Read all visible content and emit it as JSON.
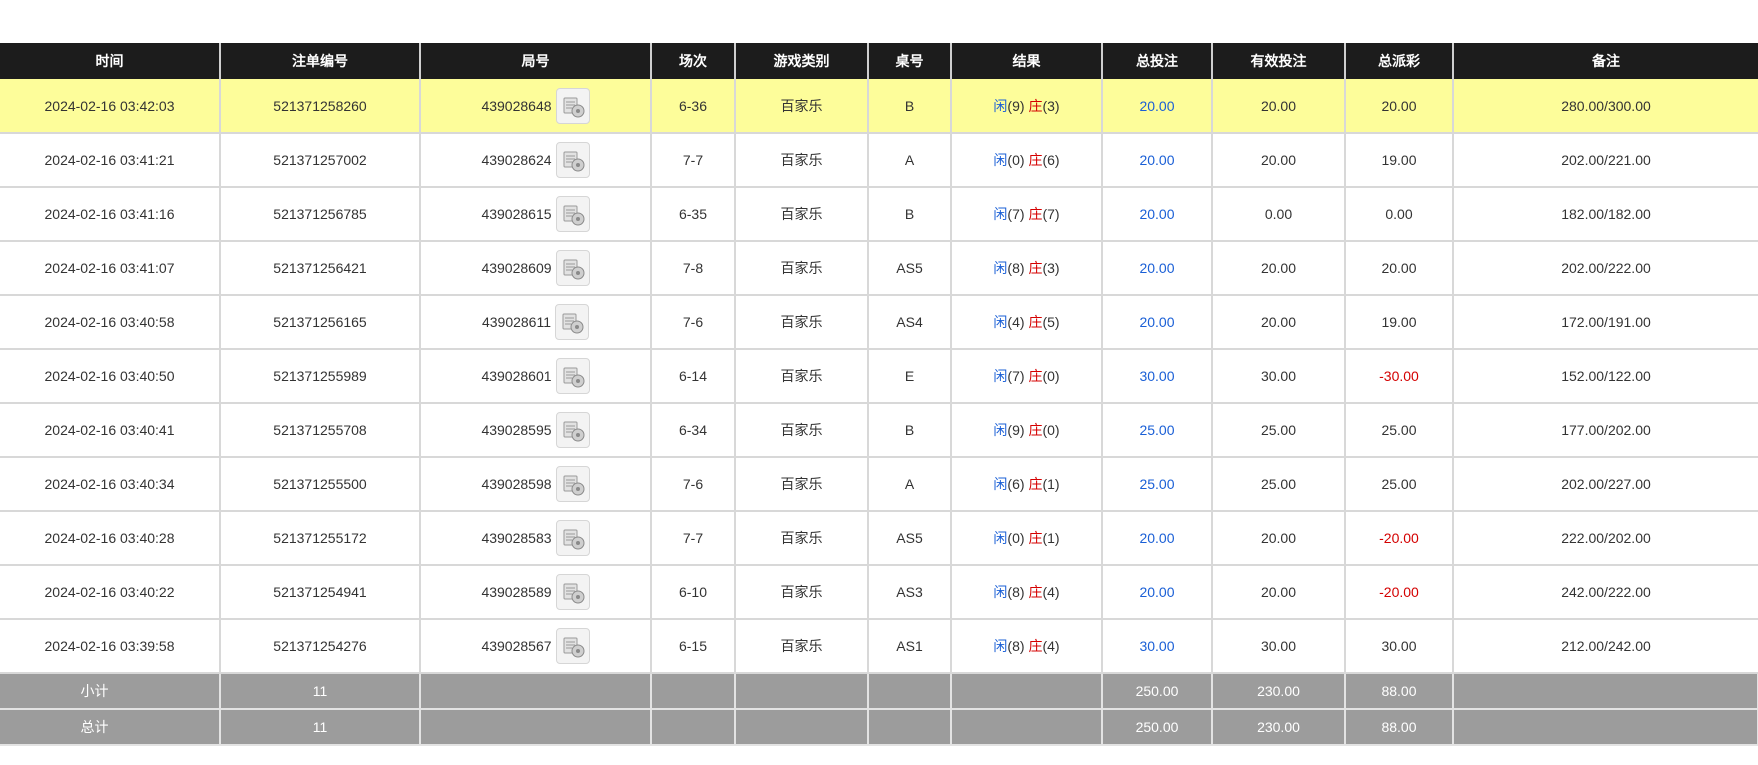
{
  "headers": [
    "时间",
    "注单编号",
    "局号",
    "场次",
    "游戏类别",
    "桌号",
    "结果",
    "总投注",
    "有效投注",
    "总派彩",
    "备注"
  ],
  "rows": [
    {
      "time": "2024-02-16 03:42:03",
      "bet_id": "521371258260",
      "round": "439028648",
      "session": "6-36",
      "game": "百家乐",
      "table": "B",
      "player_label": "闲",
      "player_score": "(9)",
      "banker_label": "庄",
      "banker_score": "(3)",
      "total_bet": "20.00",
      "valid_bet": "20.00",
      "payout": "20.00",
      "payout_negative": false,
      "note": "280.00/300.00",
      "highlight": true
    },
    {
      "time": "2024-02-16 03:41:21",
      "bet_id": "521371257002",
      "round": "439028624",
      "session": "7-7",
      "game": "百家乐",
      "table": "A",
      "player_label": "闲",
      "player_score": "(0)",
      "banker_label": "庄",
      "banker_score": "(6)",
      "total_bet": "20.00",
      "valid_bet": "20.00",
      "payout": "19.00",
      "payout_negative": false,
      "note": "202.00/221.00",
      "highlight": false
    },
    {
      "time": "2024-02-16 03:41:16",
      "bet_id": "521371256785",
      "round": "439028615",
      "session": "6-35",
      "game": "百家乐",
      "table": "B",
      "player_label": "闲",
      "player_score": "(7)",
      "banker_label": "庄",
      "banker_score": "(7)",
      "total_bet": "20.00",
      "valid_bet": "0.00",
      "payout": "0.00",
      "payout_negative": false,
      "note": "182.00/182.00",
      "highlight": false
    },
    {
      "time": "2024-02-16 03:41:07",
      "bet_id": "521371256421",
      "round": "439028609",
      "session": "7-8",
      "game": "百家乐",
      "table": "AS5",
      "player_label": "闲",
      "player_score": "(8)",
      "banker_label": "庄",
      "banker_score": "(3)",
      "total_bet": "20.00",
      "valid_bet": "20.00",
      "payout": "20.00",
      "payout_negative": false,
      "note": "202.00/222.00",
      "highlight": false
    },
    {
      "time": "2024-02-16 03:40:58",
      "bet_id": "521371256165",
      "round": "439028611",
      "session": "7-6",
      "game": "百家乐",
      "table": "AS4",
      "player_label": "闲",
      "player_score": "(4)",
      "banker_label": "庄",
      "banker_score": "(5)",
      "total_bet": "20.00",
      "valid_bet": "20.00",
      "payout": "19.00",
      "payout_negative": false,
      "note": "172.00/191.00",
      "highlight": false
    },
    {
      "time": "2024-02-16 03:40:50",
      "bet_id": "521371255989",
      "round": "439028601",
      "session": "6-14",
      "game": "百家乐",
      "table": "E",
      "player_label": "闲",
      "player_score": "(7)",
      "banker_label": "庄",
      "banker_score": "(0)",
      "total_bet": "30.00",
      "valid_bet": "30.00",
      "payout": "-30.00",
      "payout_negative": true,
      "note": "152.00/122.00",
      "highlight": false
    },
    {
      "time": "2024-02-16 03:40:41",
      "bet_id": "521371255708",
      "round": "439028595",
      "session": "6-34",
      "game": "百家乐",
      "table": "B",
      "player_label": "闲",
      "player_score": "(9)",
      "banker_label": "庄",
      "banker_score": "(0)",
      "total_bet": "25.00",
      "valid_bet": "25.00",
      "payout": "25.00",
      "payout_negative": false,
      "note": "177.00/202.00",
      "highlight": false
    },
    {
      "time": "2024-02-16 03:40:34",
      "bet_id": "521371255500",
      "round": "439028598",
      "session": "7-6",
      "game": "百家乐",
      "table": "A",
      "player_label": "闲",
      "player_score": "(6)",
      "banker_label": "庄",
      "banker_score": "(1)",
      "total_bet": "25.00",
      "valid_bet": "25.00",
      "payout": "25.00",
      "payout_negative": false,
      "note": "202.00/227.00",
      "highlight": false
    },
    {
      "time": "2024-02-16 03:40:28",
      "bet_id": "521371255172",
      "round": "439028583",
      "session": "7-7",
      "game": "百家乐",
      "table": "AS5",
      "player_label": "闲",
      "player_score": "(0)",
      "banker_label": "庄",
      "banker_score": "(1)",
      "total_bet": "20.00",
      "valid_bet": "20.00",
      "payout": "-20.00",
      "payout_negative": true,
      "note": "222.00/202.00",
      "highlight": false
    },
    {
      "time": "2024-02-16 03:40:22",
      "bet_id": "521371254941",
      "round": "439028589",
      "session": "6-10",
      "game": "百家乐",
      "table": "AS3",
      "player_label": "闲",
      "player_score": "(8)",
      "banker_label": "庄",
      "banker_score": "(4)",
      "total_bet": "20.00",
      "valid_bet": "20.00",
      "payout": "-20.00",
      "payout_negative": true,
      "note": "242.00/222.00",
      "highlight": false
    },
    {
      "time": "2024-02-16 03:39:58",
      "bet_id": "521371254276",
      "round": "439028567",
      "session": "6-15",
      "game": "百家乐",
      "table": "AS1",
      "player_label": "闲",
      "player_score": "(8)",
      "banker_label": "庄",
      "banker_score": "(4)",
      "total_bet": "30.00",
      "valid_bet": "30.00",
      "payout": "30.00",
      "payout_negative": false,
      "note": "212.00/242.00",
      "highlight": false
    }
  ],
  "subtotal": {
    "label": "小计",
    "count": "11",
    "total_bet": "250.00",
    "valid_bet": "230.00",
    "payout": "88.00"
  },
  "total": {
    "label": "总计",
    "count": "11",
    "total_bet": "250.00",
    "valid_bet": "230.00",
    "payout": "88.00"
  },
  "colors": {
    "header_bg": "#1c1c1c",
    "highlight_row": "#fdfd9a",
    "summary_bg": "#9c9c9c",
    "player_blue": "#1a5fd6",
    "negative_red": "#d40000"
  },
  "icons": {
    "round_detail": "round-detail-icon"
  }
}
